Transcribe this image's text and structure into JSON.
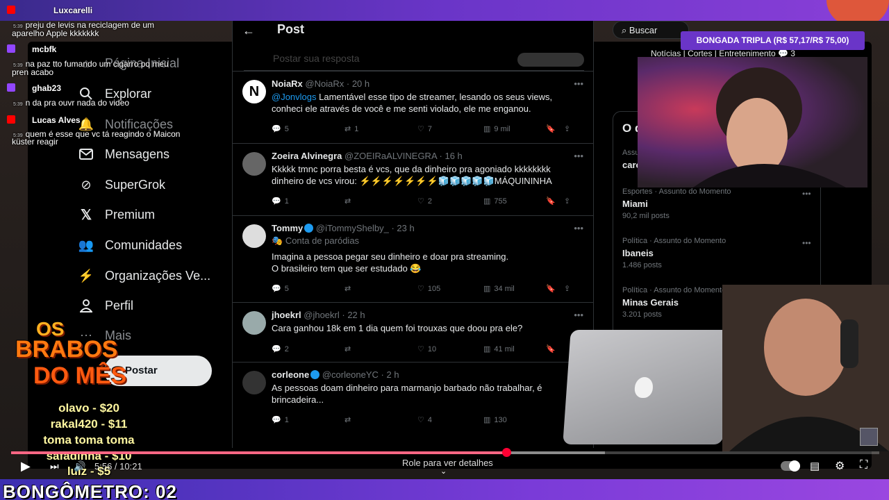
{
  "chat": [
    {
      "user": "Luxcarelli",
      "time": "5:39",
      "msg": "preju de levis na reciclagem de um",
      "msg2": "aparelho Apple kkkkkkk",
      "platform": "youtube"
    },
    {
      "user": "mcbfk",
      "time": "5:39",
      "msg": "na paz tto fumando um cigarro pq meu",
      "msg2": "pren acabo",
      "platform": "twitch"
    },
    {
      "user": "ghab23",
      "time": "5:39",
      "msg": "n da pra ouvr nada do video",
      "msg2": "",
      "platform": "twitch"
    },
    {
      "user": "Lucas Alves",
      "time": "5:39",
      "msg": "quem é esse que vc tá reagindo o Maicon",
      "msg2": "küster reagir",
      "platform": "youtube"
    }
  ],
  "nav": [
    "Página Inicial",
    "Explorar",
    "Notificações",
    "Mensagens",
    "SuperGrok",
    "Premium",
    "Comunidades",
    "Organizações Ve...",
    "Perfil",
    "Mais"
  ],
  "post_button": "Postar",
  "feed": {
    "title": "Post",
    "reply_placeholder": "Postar sua resposta",
    "tweets": [
      {
        "name": "NoiaRx",
        "handle": "@NoiaRx",
        "time": "20 h",
        "mention": "@Jonvlogs",
        "text": "Lamentável esse tipo de streamer, lesando os seus views,",
        "text2": "conheci ele através de você e me senti violado, ele me enganou.",
        "replies": "5",
        "reposts": "1",
        "likes": "7",
        "views": "9 mil"
      },
      {
        "name": "Zoeira Alvinegra",
        "handle": "@ZOEIRaALVINEGRA",
        "time": "16 h",
        "text": "Kkkkk tmnc porra besta é vcs, que da dinheiro pra agoniado kkkkkkkk",
        "text2": "dinheiro de vcs virou: ⚡⚡⚡⚡⚡⚡⚡🧊🧊🧊🧊🧊MÁQUININHA",
        "replies": "1",
        "reposts": "",
        "likes": "2",
        "views": "755"
      },
      {
        "name": "Tommy",
        "handle": "@iTommyShelby_",
        "time": "23 h",
        "tag": "Conta de paródias",
        "text": "Imagina a pessoa pegar seu dinheiro e doar pra streaming.",
        "text2": "O brasileiro tem que ser estudado 😂",
        "replies": "5",
        "reposts": "",
        "likes": "105",
        "views": "34 mil"
      },
      {
        "name": "jhoekrl",
        "handle": "@jhoekrl",
        "time": "22 h",
        "text": "Cara ganhou 18k em 1 dia quem foi trouxas que doou pra ele?",
        "text2": "",
        "replies": "2",
        "reposts": "",
        "likes": "10",
        "views": "41 mil"
      },
      {
        "name": "corleone",
        "handle": "@corleoneYC",
        "time": "2 h",
        "text": "As pessoas doam dinheiro para marmanjo barbado não trabalhar, é",
        "text2": "brincadeira...",
        "replies": "1",
        "reposts": "",
        "likes": "4",
        "views": "130"
      }
    ]
  },
  "right": {
    "search": "Buscar",
    "banner": "Notícias | Cortes | Entretenimento 💬 3",
    "section": "O q",
    "trends": [
      {
        "cat": "Assu",
        "name": "caro"
      },
      {
        "cat": "Esportes · Assunto do Momento",
        "name": "Miami",
        "posts": "90,2 mil posts"
      },
      {
        "cat": "Política · Assunto do Momento",
        "name": "Ibaneis",
        "posts": "1.486 posts"
      },
      {
        "cat": "Política · Assunto do Momento",
        "name": "Minas Gerais",
        "posts": "3.201 posts"
      }
    ]
  },
  "overlay": {
    "tripla": "BONGADA TRIPLA (R$ 57,17/R$ 75,00)",
    "brabos_line1": "OS",
    "brabos_line2": "BRABOS",
    "brabos_line3": "DO MÊS",
    "donations": [
      "olavo - $20",
      "rakal420 - $11",
      "toma toma toma",
      "safadinha - $10",
      "luiz - $5"
    ],
    "bongometro": "BONGÔMETRO: 02"
  },
  "player": {
    "time": "5:56 / 10:21",
    "hint": "Role para ver detalhes",
    "progress": 0.57
  }
}
